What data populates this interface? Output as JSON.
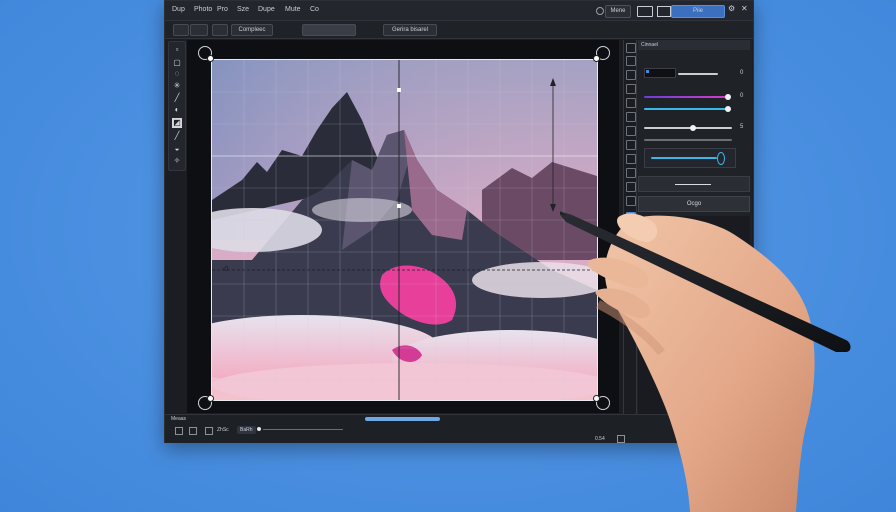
{
  "menubar": {
    "items": [
      "Dup",
      "Photo",
      "Pro",
      "Sze",
      "Dupe",
      "Mute",
      "Co"
    ],
    "right_buttons": [
      "Mene",
      "Piie"
    ]
  },
  "options_bar": {
    "dropdown": "Compleec",
    "field_label": "Gerira bisarel"
  },
  "panel": {
    "header": "Cinnael",
    "slider_values": [
      "0",
      "0",
      "5"
    ],
    "button_label": "Ocgo"
  },
  "status": {
    "left_labels": [
      "Meaas",
      "ZhSc",
      "BaRh"
    ],
    "right_value": "0.54"
  },
  "canvas": {
    "guide_marker": "-0"
  },
  "colors": {
    "accent": "#4d86d6",
    "slider_pink": "#d33bd0",
    "slider_cyan": "#3bb8e8",
    "background": "#4f93e3"
  }
}
